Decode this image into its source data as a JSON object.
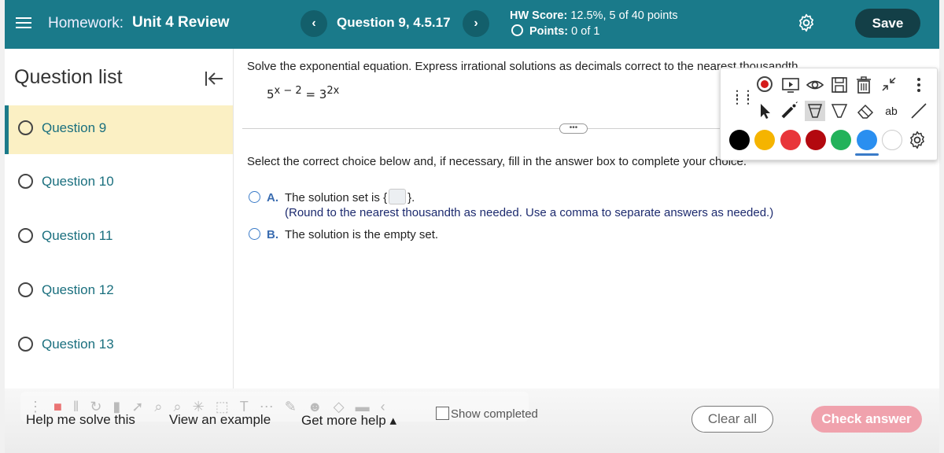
{
  "header": {
    "hw_prefix": "Homework:",
    "hw_title": "Unit 4 Review",
    "prev_glyph": "‹",
    "next_glyph": "›",
    "question_title": "Question 9, 4.5.17",
    "hw_score_label": "HW Score:",
    "hw_score_value": "12.5%, 5 of 40 points",
    "points_label": "Points:",
    "points_value": "0 of 1",
    "save_label": "Save",
    "color_bar": "#1a7a8a",
    "color_save": "#133f47"
  },
  "sidebar": {
    "title": "Question list",
    "items": [
      {
        "label": "Question 9",
        "active": true
      },
      {
        "label": "Question 10",
        "active": false
      },
      {
        "label": "Question 11",
        "active": false
      },
      {
        "label": "Question 12",
        "active": false
      },
      {
        "label": "Question 13",
        "active": false
      }
    ]
  },
  "main": {
    "prompt": "Solve the exponential equation. Express irrational solutions as decimals correct to the nearest thousandth.",
    "equation": {
      "base1": "5",
      "exp1": "x − 2",
      "equals": " = ",
      "base2": "3",
      "exp2": "2x"
    },
    "divider_glyph": "•••",
    "instructions": "Select the correct choice below and, if necessary, fill in the answer box to complete your choice.",
    "choice_a": {
      "letter": "A.",
      "text_before": "The solution set is",
      "open_brace": "{",
      "close_brace": "}.",
      "hint": "(Round to the nearest thousandth as needed. Use a comma to separate answers as needed.)"
    },
    "choice_b": {
      "letter": "B.",
      "text": "The solution is the empty set."
    }
  },
  "annotation_toolbar": {
    "tools_row1": [
      "record-icon",
      "play-screen-icon",
      "eye-icon",
      "save-disk-icon",
      "trash-icon",
      "shrink-icon",
      "more-vertical-icon"
    ],
    "tools_row2": [
      "pointer-icon",
      "laser-pen-icon",
      "highlighter-icon",
      "marker-icon",
      "eraser-icon",
      "text-icon",
      "line-icon"
    ],
    "text_tool_label": "ab",
    "colors": [
      "#000000",
      "#f5b400",
      "#e8353a",
      "#b3090f",
      "#22b25a",
      "#2a8ff0",
      "#ffffff"
    ],
    "selected_color": "#2a8ff0"
  },
  "bottom": {
    "help_label": "Help me solve this",
    "example_label": "View an example",
    "more_help_label": "Get more help ▴",
    "show_completed_label": "Show completed",
    "clear_label": "Clear all",
    "check_label": "Check answer"
  }
}
